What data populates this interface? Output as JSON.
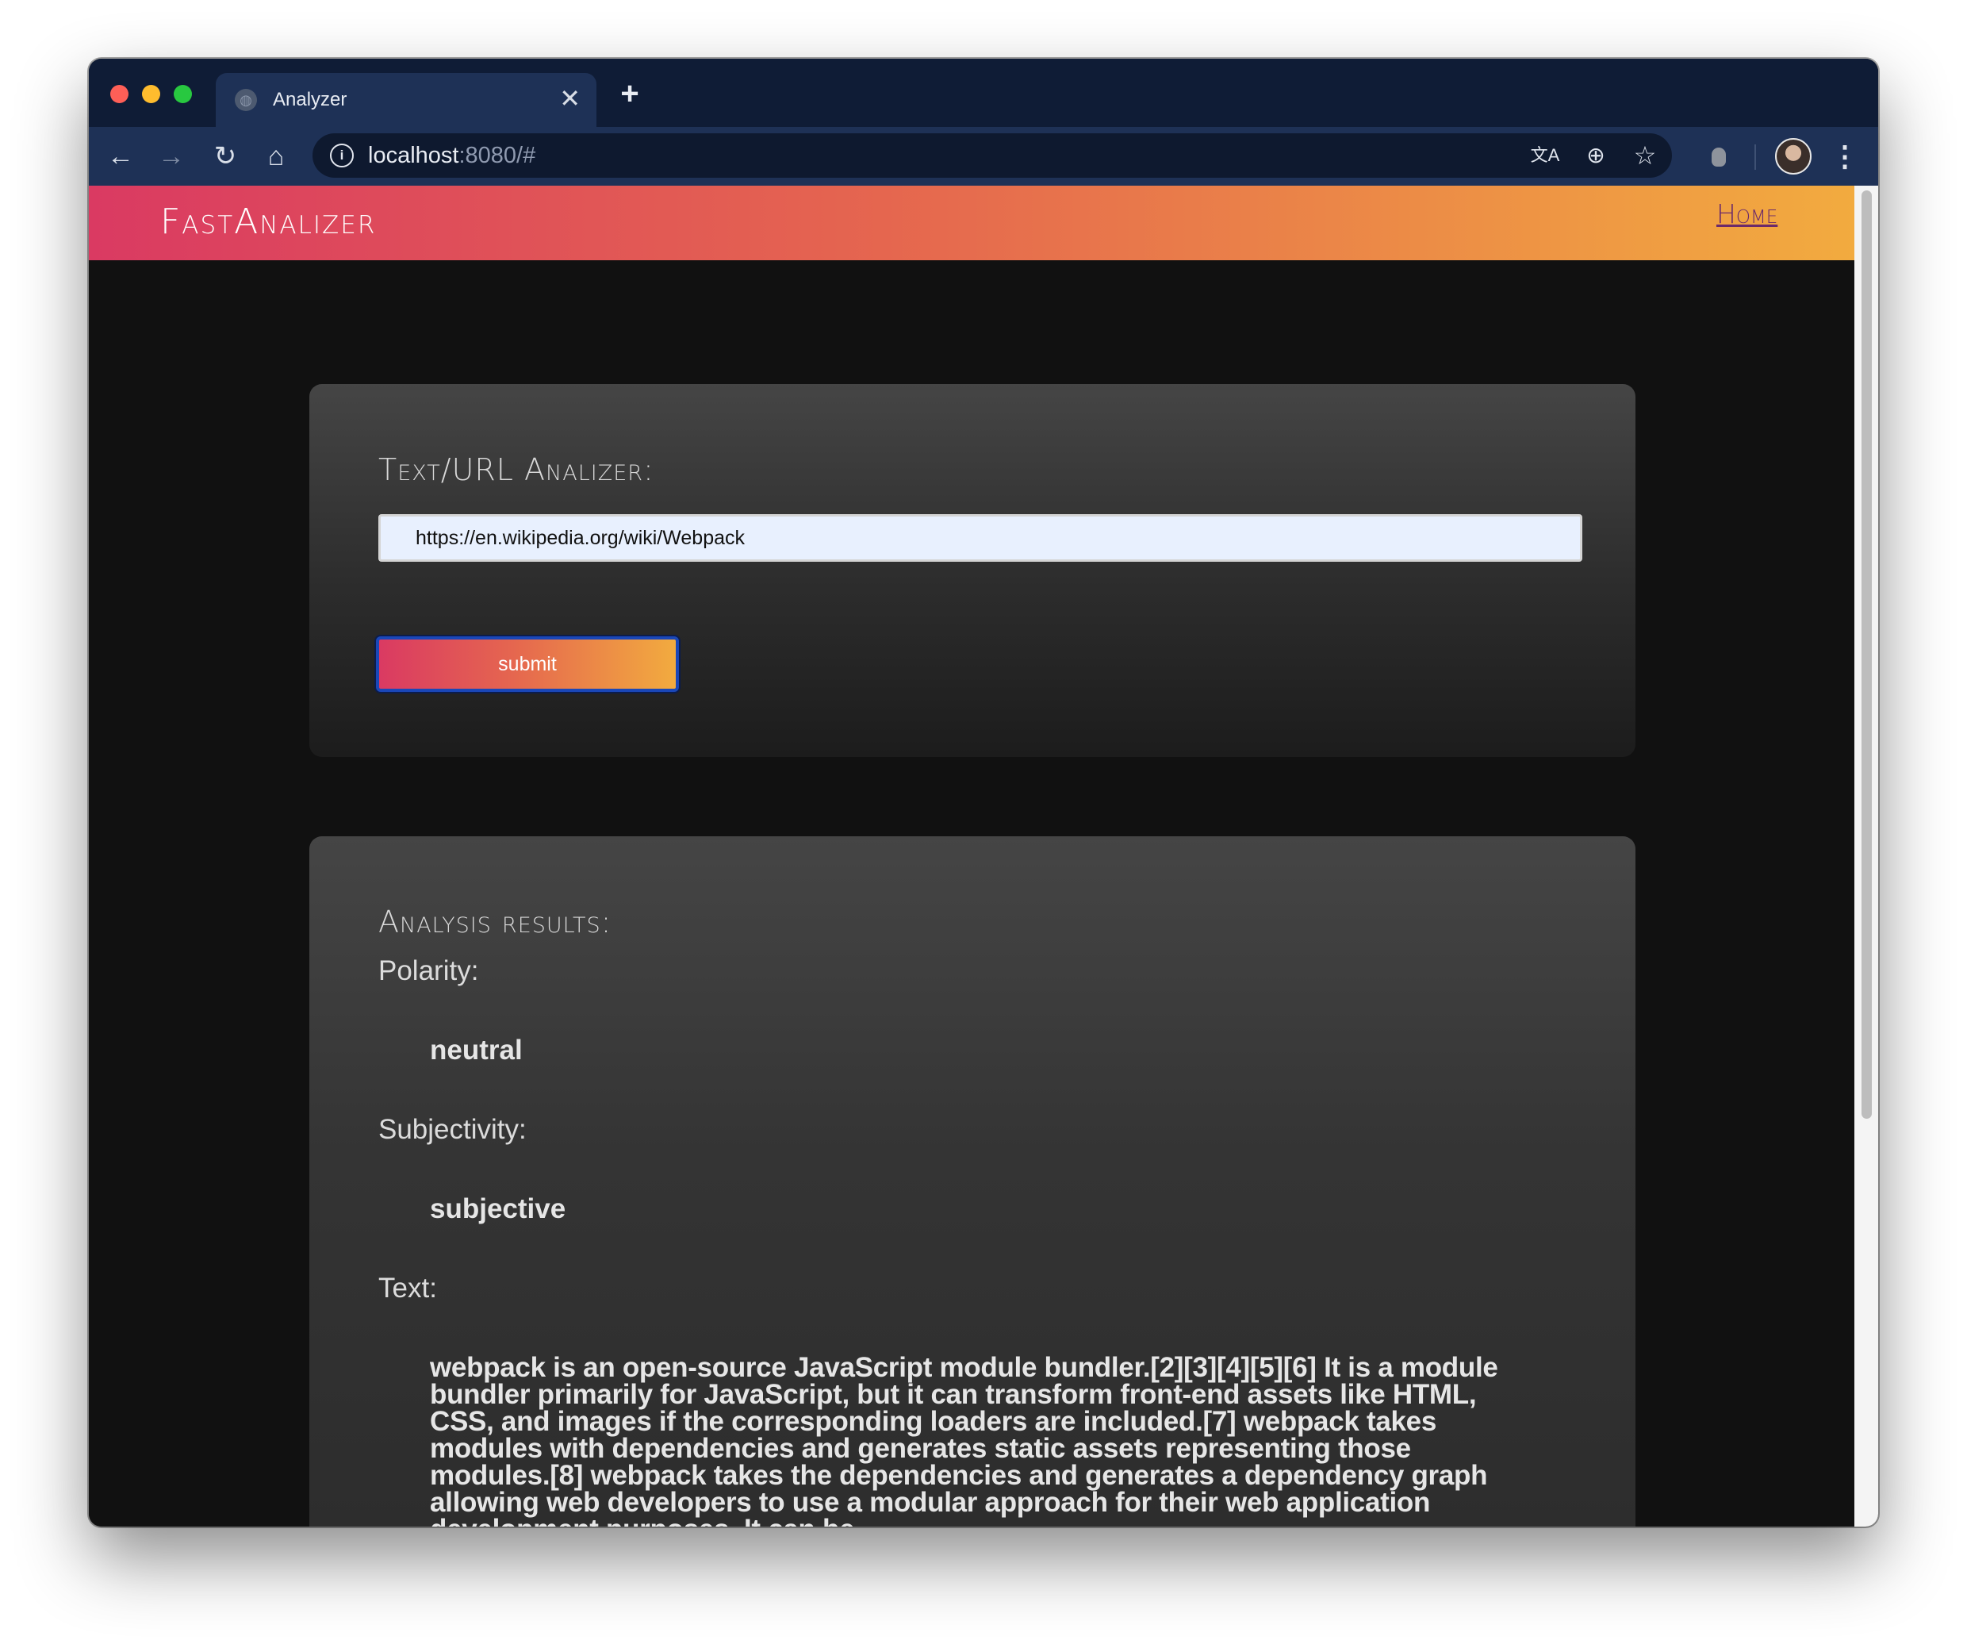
{
  "browser": {
    "tab_title": "Analyzer",
    "tab_close": "✕",
    "new_tab": "+",
    "url_host": "localhost",
    "url_rest": ":8080/#"
  },
  "site": {
    "logo": "FastAnalizer",
    "nav_home": "Home"
  },
  "form": {
    "title": "Text/URL Analizer:",
    "input_value": "https://en.wikipedia.org/wiki/Webpack",
    "submit_label": "submit"
  },
  "results": {
    "title": "Analysis results:",
    "polarity_label": "Polarity:",
    "polarity_value": "neutral",
    "subjectivity_label": "Subjectivity:",
    "subjectivity_value": "subjective",
    "text_label": "Text:",
    "text_value": "webpack is an open-source JavaScript module bundler.[2][3][4][5][6] It is a module bundler primarily for JavaScript, but it can transform front-end assets like HTML, CSS, and images if the corresponding loaders are included.[7] webpack takes modules with dependencies and generates static assets representing those modules.[8] webpack takes the dependencies and generates a dependency graph allowing web developers to use a modular approach for their web application development purposes. It can be"
  },
  "colors": {
    "header_gradient_start": "#da3a62",
    "header_gradient_end": "#f2ab3f",
    "page_background": "#111111",
    "submit_focus_ring": "#1a47b8"
  }
}
